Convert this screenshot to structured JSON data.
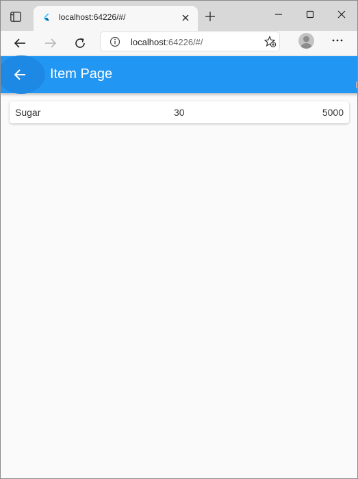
{
  "browser": {
    "tab": {
      "title": "localhost:64226/#/"
    },
    "address": {
      "host": "localhost",
      "rest": ":64226/#/"
    }
  },
  "app": {
    "title": "Item Page",
    "accent": "#2196f3"
  },
  "items": [
    {
      "name": "Sugar",
      "quantity": "30",
      "price": "5000"
    }
  ]
}
